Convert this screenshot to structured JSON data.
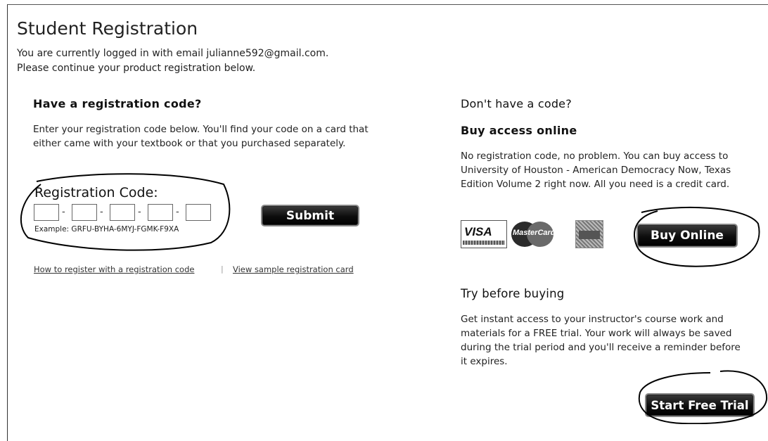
{
  "page": {
    "title": "Student Registration",
    "intro_line1": "You are currently logged in with email julianne592@gmail.com.",
    "intro_line2": "Please continue your product registration below."
  },
  "left": {
    "heading": "Have a registration code?",
    "description": "Enter your registration code below. You'll find your code on a card that either came with your textbook or that you purchased separately.",
    "code_label": "Registration Code:",
    "code_fields": [
      "",
      "",
      "",
      "",
      ""
    ],
    "example": "Example: GRFU-BYHA-6MYJ-FGMK-F9XA",
    "submit_label": "Submit",
    "link_how": "How to register with a registration code",
    "separator": "|",
    "link_sample": "View sample registration card"
  },
  "right": {
    "heading": "Don't have a code?",
    "buy_heading": "Buy access online",
    "buy_description": "No registration code, no problem. You can buy access to University of Houston - American Democracy Now, Texas Edition Volume 2 right now. All you need is a credit card.",
    "cards": {
      "visa": "VISA",
      "mastercard": "MasterCard"
    },
    "buy_button": "Buy Online",
    "trial_heading": "Try before buying",
    "trial_description": "Get instant access to your instructor's course work and materials for a FREE trial. Your work will always be saved during the trial period and you'll receive a reminder before it expires.",
    "trial_button": "Start Free Trial"
  },
  "colors": {
    "button_bg": "#000000",
    "button_text": "#ffffff",
    "annotation_ink": "#000000"
  }
}
